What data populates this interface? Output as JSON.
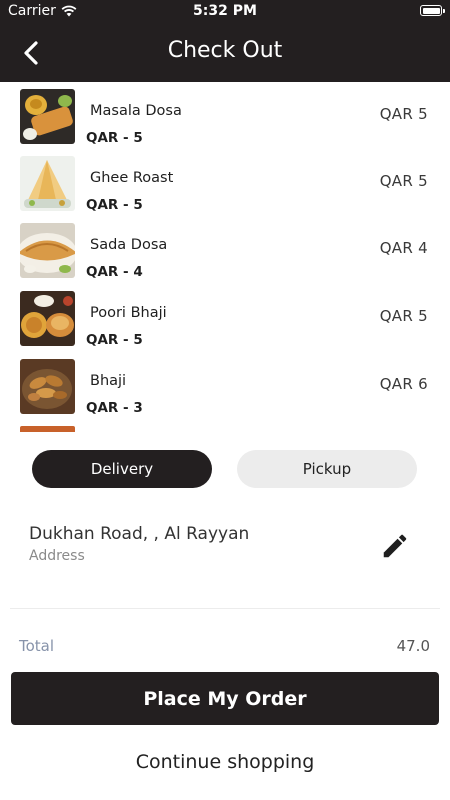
{
  "status_bar": {
    "carrier": "Carrier",
    "time": "5:32 PM"
  },
  "header": {
    "title": "Check Out"
  },
  "cart_items": [
    {
      "name": "Masala Dosa",
      "subtitle": "QAR - 5",
      "price": "QAR 5"
    },
    {
      "name": "Ghee Roast",
      "subtitle": "QAR - 5",
      "price": "QAR 5"
    },
    {
      "name": "Sada Dosa",
      "subtitle": "QAR - 4",
      "price": "QAR 4"
    },
    {
      "name": "Poori Bhaji",
      "subtitle": "QAR - 5",
      "price": "QAR 5"
    },
    {
      "name": "Bhaji",
      "subtitle": "QAR - 3",
      "price": "QAR 6"
    }
  ],
  "delivery_options": {
    "delivery": "Delivery",
    "pickup": "Pickup",
    "selected": "Delivery"
  },
  "address": {
    "line": "Dukhan Road, , Al Rayyan",
    "label": "Address"
  },
  "totals": {
    "label": "Total",
    "value": "47.0"
  },
  "actions": {
    "place_order": "Place My Order",
    "continue_shopping": "Continue shopping"
  },
  "colors": {
    "primary": "#231f20",
    "secondary_button": "#ececec",
    "total_label": "#8793aa"
  }
}
